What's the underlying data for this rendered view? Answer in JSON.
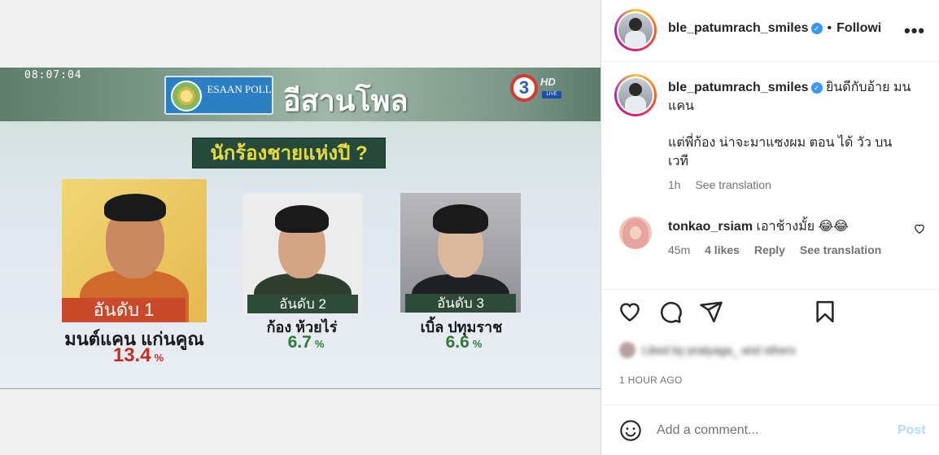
{
  "image": {
    "tv_time": "08:07:04",
    "poll_logo_text": "ESAAN POLL",
    "poll_title": "อีสานโพล",
    "channel_number": "3",
    "channel_hd": "HD",
    "channel_live": "LIVE",
    "question": "นักร้องชายแห่งปี ?",
    "candidates": [
      {
        "rank": "อันดับ 1",
        "name": "มนต์แคน แก่นคูณ",
        "percent": "13.4",
        "percent_sign": "%"
      },
      {
        "rank": "อันดับ 2",
        "name": "ก้อง ห้วยไร่",
        "percent": "6.7",
        "percent_sign": "%"
      },
      {
        "rank": "อันดับ 3",
        "name": "เบิ้ล ปทุมราช",
        "percent": "6.6",
        "percent_sign": "%"
      }
    ]
  },
  "header": {
    "username": "ble_patumrach_smiles",
    "verified_mark": "✓",
    "separator": "•",
    "follow_label": "Followi",
    "more_label": "•••"
  },
  "caption": {
    "username": "ble_patumrach_smiles",
    "verified_mark": "✓",
    "text_line1": "ยินดีกับอ้าย มนแคน",
    "text_line2": "แต่พี่ก้อง น่าจะมาแซงผม ตอน ได้ วัว บน เวที",
    "time": "1h",
    "see_translation": "See translation"
  },
  "comment": {
    "username": "tonkao_rsiam",
    "text": "เอาช้างมั้ย 😂😂",
    "time": "45m",
    "likes": "4 likes",
    "reply": "Reply",
    "see_translation": "See translation"
  },
  "likes_line": "Liked by pratyaga_ and others",
  "timestamp": "1 HOUR AGO",
  "add_comment": {
    "placeholder": "Add a comment...",
    "post_label": "Post"
  },
  "colors": {
    "accent_blue": "#0095f6",
    "post_disabled": "#b3dbff",
    "verified_blue": "#3897f0",
    "rank1_bar": "#c84a2b",
    "rank_bar_dark": "#2e4a38",
    "pct_red": "#c62d24",
    "pct_green": "#2f7a35"
  },
  "icons": [
    "heart-icon",
    "comment-icon",
    "share-icon",
    "bookmark-icon",
    "emoji-icon",
    "more-icon",
    "heart-small-icon"
  ]
}
